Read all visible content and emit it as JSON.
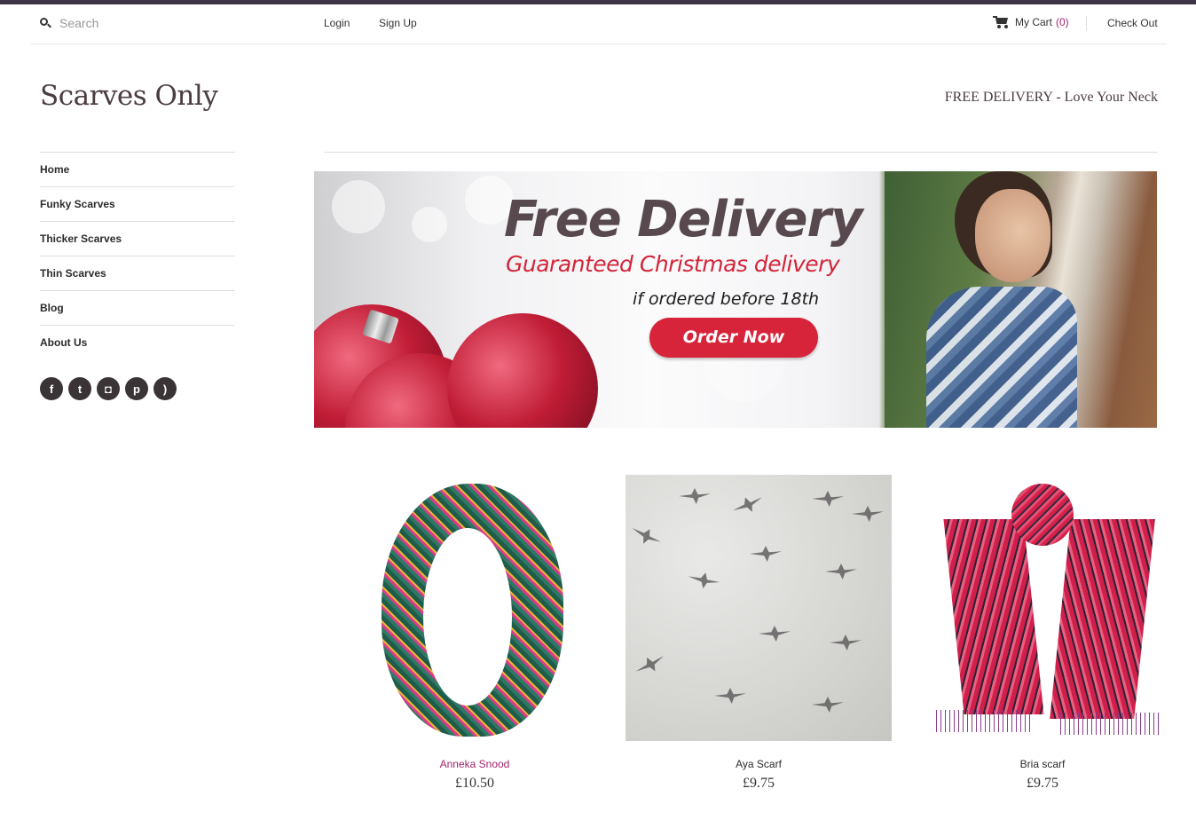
{
  "search": {
    "placeholder": "Search"
  },
  "account": {
    "login": "Login",
    "signup": "Sign Up"
  },
  "cart": {
    "label": "My Cart",
    "count": "(0)",
    "checkout": "Check Out"
  },
  "site": {
    "title": "Scarves Only",
    "tagline": "FREE DELIVERY - Love Your Neck"
  },
  "nav": {
    "items": [
      {
        "label": "Home"
      },
      {
        "label": "Funky Scarves"
      },
      {
        "label": "Thicker Scarves"
      },
      {
        "label": "Thin Scarves"
      },
      {
        "label": "Blog"
      },
      {
        "label": "About Us"
      }
    ]
  },
  "social": {
    "icons": [
      "facebook-icon",
      "twitter-icon",
      "instagram-icon",
      "pinterest-icon",
      "rss-icon"
    ],
    "glyphs": [
      "f",
      "t",
      "◘",
      "p",
      ")"
    ]
  },
  "banner": {
    "title": "Free Delivery",
    "subtitle": "Guaranteed Christmas delivery",
    "note": "if ordered before 18th",
    "cta": "Order Now"
  },
  "products": [
    {
      "name": "Anneka Snood",
      "price": "£10.50"
    },
    {
      "name": "Aya Scarf",
      "price": "£9.75"
    },
    {
      "name": "Bria scarf",
      "price": "£9.75"
    }
  ],
  "colors": {
    "accent": "#a2256e",
    "topstrip": "#3d3446",
    "banner_red": "#d8243a"
  }
}
